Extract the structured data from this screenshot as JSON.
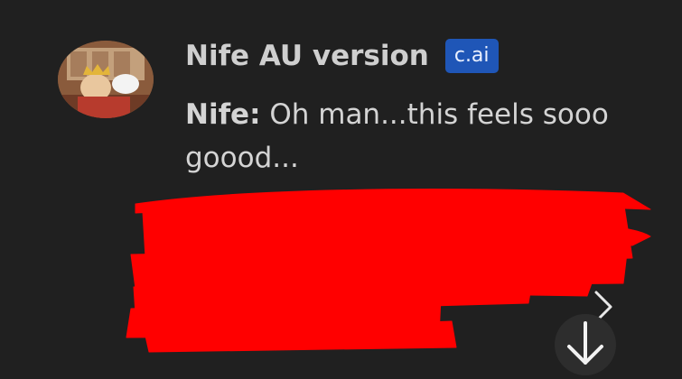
{
  "message": {
    "character_name": "Nife AU version",
    "badge": "c.ai",
    "speaker": "Nife:",
    "text": " Oh man...this feels sooo goood..."
  },
  "icons": {
    "next": "chevron-right-icon",
    "scroll": "arrow-down-icon"
  },
  "colors": {
    "background": "#202020",
    "badge": "#1f56b7",
    "redaction": "#ff0000"
  }
}
